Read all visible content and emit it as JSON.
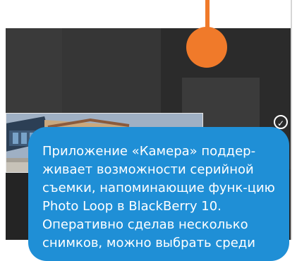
{
  "callout": {
    "text": "Приложение «Камера» поддер-живает возможности серийной съемки, напоминающие функ-цию Photo Loop в BlackBerry 10. Оперативно сделав несколько снимков, можно выбрать среди"
  },
  "controls": {
    "confirm_icon": "check-icon",
    "undo_icon": "undo-icon"
  },
  "colors": {
    "accent": "#1f8fd6",
    "marker": "#f07a2a"
  }
}
